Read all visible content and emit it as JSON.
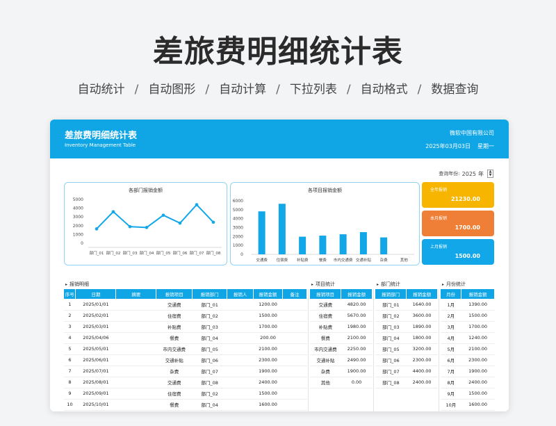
{
  "hero": {
    "title": "差旅费明细统计表",
    "features": [
      "自动统计",
      "自动图形",
      "自动计算",
      "下拉列表",
      "自动格式",
      "数据查询"
    ],
    "separator": "/"
  },
  "header": {
    "title": "差旅费明细统计表",
    "subtitle": "Inventory Management Table",
    "company": "微软中国有限公司",
    "date": "2025年03月03日",
    "weekday": "星期一"
  },
  "query": {
    "label": "查询年份:",
    "year": "2025",
    "unit": "年",
    "up": "▲",
    "down": "▼"
  },
  "colors": {
    "accent": "#10a6e6",
    "kpi_year": "#f7b500",
    "kpi_month": "#ef7f36",
    "kpi_last": "#12a7e8"
  },
  "kpis": [
    {
      "label": "全年报销",
      "value": "21230.00"
    },
    {
      "label": "本月报销",
      "value": "1700.00"
    },
    {
      "label": "上月报销",
      "value": "1500.00"
    }
  ],
  "chart_data": [
    {
      "type": "line",
      "title": "各部门报销金额",
      "categories": [
        "部门_01",
        "部门_02",
        "部门_03",
        "部门_04",
        "部门_05",
        "部门_06",
        "部门_07",
        "部门_08"
      ],
      "values": [
        1640,
        3600,
        1890,
        1800,
        3200,
        2300,
        4400,
        2400
      ],
      "ylim": [
        0,
        5000
      ],
      "yticks": [
        "0",
        "1000",
        "2000",
        "3000",
        "4000",
        "5000"
      ],
      "color": "#12a7e8"
    },
    {
      "type": "bar",
      "title": "各项目报销金额",
      "categories": [
        "交通费",
        "住宿费",
        "补贴费",
        "餐费",
        "市内交通费",
        "交通补贴",
        "杂费",
        "其他"
      ],
      "values": [
        4820,
        5670,
        1980,
        2100,
        2250,
        2490,
        1900,
        0
      ],
      "ylim": [
        0,
        6000
      ],
      "yticks": [
        "0",
        "1000",
        "2000",
        "3000",
        "4000",
        "5000",
        "6000"
      ],
      "color": "#12a7e8"
    }
  ],
  "detail": {
    "label": "报销明细",
    "headers": [
      "序号",
      "日期",
      "摘要",
      "报销项目",
      "报销部门",
      "报销人",
      "报销金额",
      "备注"
    ],
    "rows": [
      [
        "1",
        "2025/01/01",
        "",
        "交通费",
        "部门_01",
        "",
        "1200.00",
        ""
      ],
      [
        "2",
        "2025/02/01",
        "",
        "住宿费",
        "部门_02",
        "",
        "1500.00",
        ""
      ],
      [
        "3",
        "2025/03/01",
        "",
        "补贴费",
        "部门_03",
        "",
        "1700.00",
        ""
      ],
      [
        "4",
        "2025/04/06",
        "",
        "餐费",
        "部门_04",
        "",
        "200.00",
        ""
      ],
      [
        "5",
        "2025/05/01",
        "",
        "市内交通费",
        "部门_05",
        "",
        "2100.00",
        ""
      ],
      [
        "6",
        "2025/06/01",
        "",
        "交通补贴",
        "部门_06",
        "",
        "2300.00",
        ""
      ],
      [
        "7",
        "2025/07/01",
        "",
        "杂费",
        "部门_07",
        "",
        "1900.00",
        ""
      ],
      [
        "8",
        "2025/08/01",
        "",
        "交通费",
        "部门_08",
        "",
        "2400.00",
        ""
      ],
      [
        "9",
        "2025/09/01",
        "",
        "住宿费",
        "部门_02",
        "",
        "1500.00",
        ""
      ],
      [
        "10",
        "2025/10/01",
        "",
        "餐费",
        "部门_04",
        "",
        "1600.00",
        ""
      ]
    ]
  },
  "project_stats": {
    "label": "项目统计",
    "headers": [
      "报销项目",
      "报销金额"
    ],
    "rows": [
      [
        "交通费",
        "4820.00"
      ],
      [
        "住宿费",
        "5670.00"
      ],
      [
        "补贴费",
        "1980.00"
      ],
      [
        "餐费",
        "2100.00"
      ],
      [
        "市内交通费",
        "2250.00"
      ],
      [
        "交通补贴",
        "2490.00"
      ],
      [
        "杂费",
        "1900.00"
      ],
      [
        "其他",
        "0.00"
      ]
    ]
  },
  "dept_stats": {
    "label": "部门统计",
    "headers": [
      "报销部门",
      "报销金额"
    ],
    "rows": [
      [
        "部门_01",
        "1640.00"
      ],
      [
        "部门_02",
        "3600.00"
      ],
      [
        "部门_03",
        "1890.00"
      ],
      [
        "部门_04",
        "1800.00"
      ],
      [
        "部门_05",
        "3200.00"
      ],
      [
        "部门_06",
        "2300.00"
      ],
      [
        "部门_07",
        "4400.00"
      ],
      [
        "部门_08",
        "2400.00"
      ]
    ]
  },
  "month_stats": {
    "label": "月份统计",
    "headers": [
      "月份",
      "报销金额"
    ],
    "rows": [
      [
        "1月",
        "1390.00"
      ],
      [
        "2月",
        "1500.00"
      ],
      [
        "3月",
        "1700.00"
      ],
      [
        "4月",
        "1240.00"
      ],
      [
        "5月",
        "2100.00"
      ],
      [
        "6月",
        "2300.00"
      ],
      [
        "7月",
        "1900.00"
      ],
      [
        "8月",
        "2400.00"
      ],
      [
        "9月",
        "1500.00"
      ],
      [
        "10月",
        "1600.00"
      ]
    ]
  }
}
